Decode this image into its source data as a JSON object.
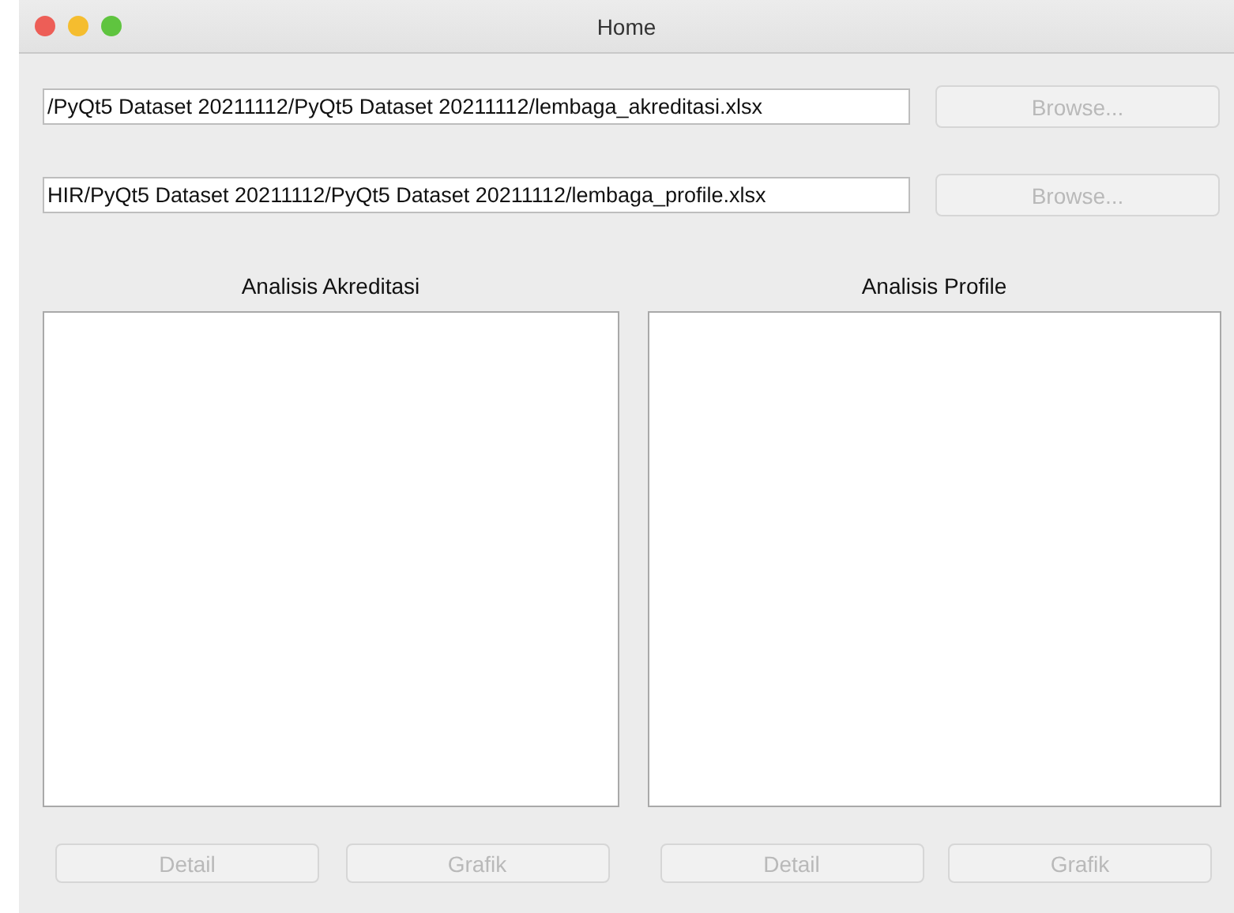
{
  "window": {
    "title": "Home"
  },
  "files": [
    {
      "value": "/PyQt5 Dataset 20211112/PyQt5 Dataset 20211112/lembaga_akreditasi.xlsx",
      "button": {
        "label": "Browse...",
        "disabled": true
      }
    },
    {
      "value": "HIR/PyQt5 Dataset 20211112/PyQt5 Dataset 20211112/lembaga_profile.xlsx",
      "button": {
        "label": "Browse...",
        "disabled": true
      }
    }
  ],
  "panels": [
    {
      "title": "Analisis Akreditasi",
      "buttons": [
        {
          "label": "Detail",
          "disabled": true
        },
        {
          "label": "Grafik",
          "disabled": true
        }
      ]
    },
    {
      "title": "Analisis Profile",
      "buttons": [
        {
          "label": "Detail",
          "disabled": true
        },
        {
          "label": "Grafik",
          "disabled": true
        }
      ]
    }
  ]
}
